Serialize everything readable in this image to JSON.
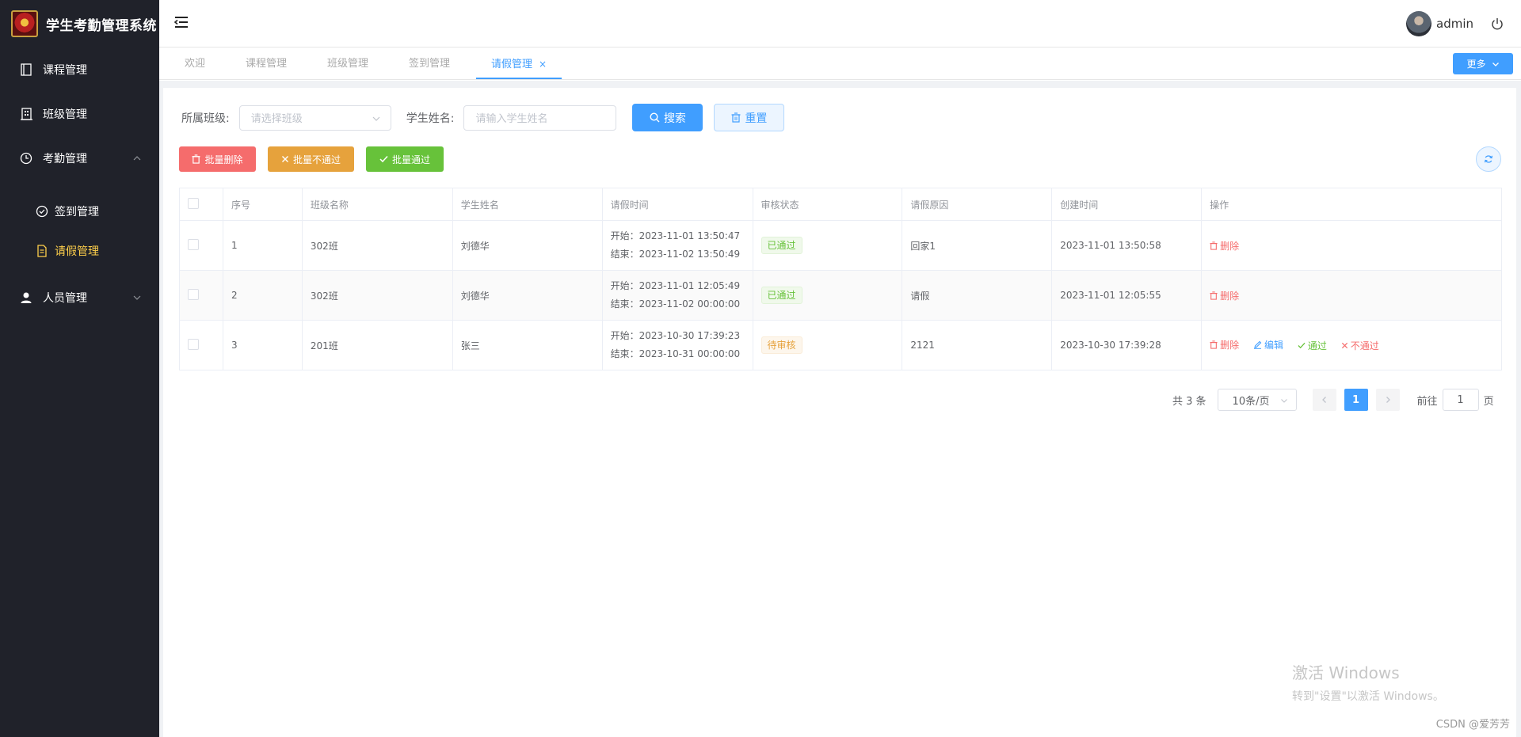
{
  "app": {
    "title": "学生考勤管理系统"
  },
  "sidebar": {
    "items": [
      {
        "label": "课程管理",
        "icon": "notebook-icon"
      },
      {
        "label": "班级管理",
        "icon": "building-icon"
      },
      {
        "label": "考勤管理",
        "icon": "clock-icon",
        "expanded": true,
        "children": [
          {
            "label": "签到管理",
            "icon": "circle-check-icon"
          },
          {
            "label": "请假管理",
            "icon": "document-icon",
            "active": true
          }
        ]
      },
      {
        "label": "人员管理",
        "icon": "user-icon"
      }
    ]
  },
  "header": {
    "username": "admin"
  },
  "tags": {
    "items": [
      "欢迎",
      "课程管理",
      "班级管理",
      "签到管理",
      "请假管理"
    ],
    "active": "请假管理",
    "close": "×",
    "more_label": "更多"
  },
  "filters": {
    "class_label": "所属班级:",
    "class_placeholder": "请选择班级",
    "name_label": "学生姓名:",
    "name_placeholder": "请输入学生姓名",
    "search_label": "搜索",
    "reset_label": "重置"
  },
  "actions": {
    "batch_delete": "批量删除",
    "batch_reject": "批量不通过",
    "batch_pass": "批量通过"
  },
  "table": {
    "headers": [
      "序号",
      "班级名称",
      "学生姓名",
      "请假时间",
      "审核状态",
      "请假原因",
      "创建时间",
      "操作"
    ],
    "rows": [
      {
        "index": "1",
        "class_name": "302班",
        "student": "刘德华",
        "start": "开始：2023-11-01 13:50:47",
        "end": "结束：2023-11-02 13:50:49",
        "status": "已通过",
        "reason": "回家1",
        "created": "2023-11-01 13:50:58"
      },
      {
        "index": "2",
        "class_name": "302班",
        "student": "刘德华",
        "start": "开始：2023-11-01 12:05:49",
        "end": "结束：2023-11-02 00:00:00",
        "status": "已通过",
        "reason": "请假",
        "created": "2023-11-01 12:05:55"
      },
      {
        "index": "3",
        "class_name": "201班",
        "student": "张三",
        "start": "开始：2023-10-30 17:39:23",
        "end": "结束：2023-10-31 00:00:00",
        "status": "待审核",
        "reason": "2121",
        "created": "2023-10-30 17:39:28"
      }
    ],
    "ops": {
      "delete": "删除",
      "edit": "编辑",
      "pass": "通过",
      "reject": "不通过"
    }
  },
  "pagination": {
    "total": "共 3 条",
    "page_size": "10条/页",
    "current": "1",
    "goto_prefix": "前往",
    "goto_value": "1",
    "goto_suffix": "页"
  },
  "watermarks": {
    "windows_line1": "激活 Windows",
    "windows_line2": "转到\"设置\"以激活 Windows。",
    "csdn": "CSDN @爱芳芳"
  },
  "colors": {
    "primary": "#409eff",
    "danger": "#f56c6c",
    "warning": "#e6a23c",
    "success": "#67c23a",
    "sidebar_bg": "#20222a",
    "active_menu": "#ffd04b"
  }
}
